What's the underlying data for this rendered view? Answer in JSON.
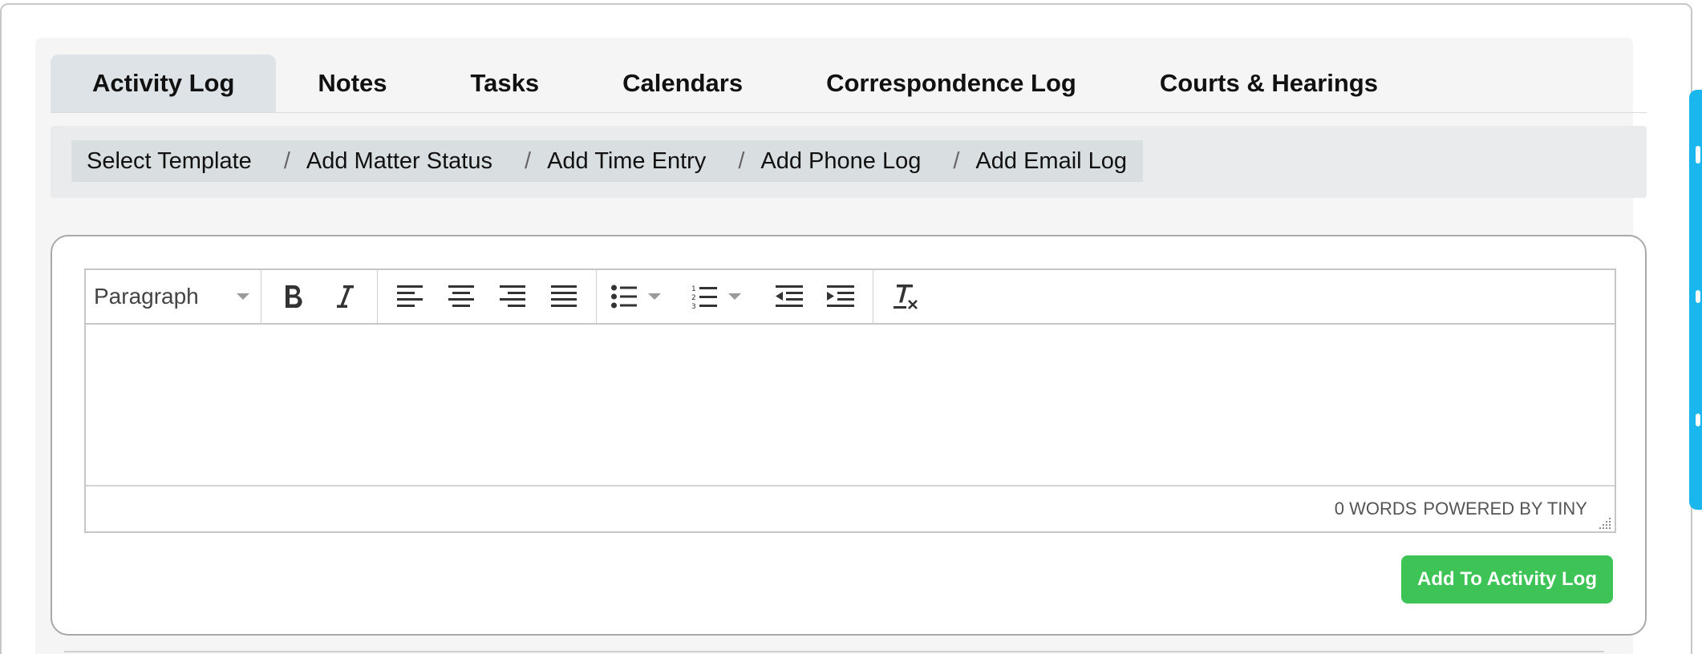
{
  "tabs": [
    {
      "label": "Activity Log"
    },
    {
      "label": "Notes"
    },
    {
      "label": "Tasks"
    },
    {
      "label": "Calendars"
    },
    {
      "label": "Correspondence Log"
    },
    {
      "label": "Courts & Hearings"
    }
  ],
  "breadcrumbs": [
    {
      "label": "Select Template"
    },
    {
      "label": "Add Matter Status"
    },
    {
      "label": "Add Time Entry"
    },
    {
      "label": "Add Phone Log"
    },
    {
      "label": "Add Email Log"
    }
  ],
  "separator": "/",
  "editor": {
    "format_value": "Paragraph",
    "word_count": "0 WORDS",
    "branding": "POWERED BY TINY"
  },
  "submit_label": "Add To Activity Log",
  "colors": {
    "submit": "#3ec456",
    "side_tab": "#1ab7ef",
    "active_tab": "#dde3e6"
  }
}
